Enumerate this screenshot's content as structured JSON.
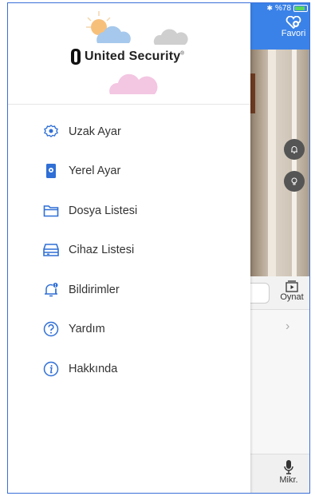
{
  "status_bar": {
    "battery_text": "%78"
  },
  "background_app": {
    "favorite_label": "Favori",
    "play_label": "Oynat",
    "mic_label": "Mikr.",
    "chevron": "›"
  },
  "drawer": {
    "logo_text": "United Security",
    "logo_mark": "®",
    "menu_items": [
      {
        "label": "Uzak Ayar",
        "icon": "remote-settings-gear-icon"
      },
      {
        "label": "Yerel Ayar",
        "icon": "local-settings-phone-icon"
      },
      {
        "label": "Dosya Listesi",
        "icon": "folder-icon"
      },
      {
        "label": "Cihaz Listesi",
        "icon": "device-list-icon"
      },
      {
        "label": "Bildirimler",
        "icon": "bell-notification-icon"
      },
      {
        "label": "Yardım",
        "icon": "help-question-icon"
      },
      {
        "label": "Hakkında",
        "icon": "info-icon"
      }
    ]
  },
  "colors": {
    "accent": "#3b82e8",
    "icon_blue": "#2f6fd6",
    "text": "#333333"
  }
}
